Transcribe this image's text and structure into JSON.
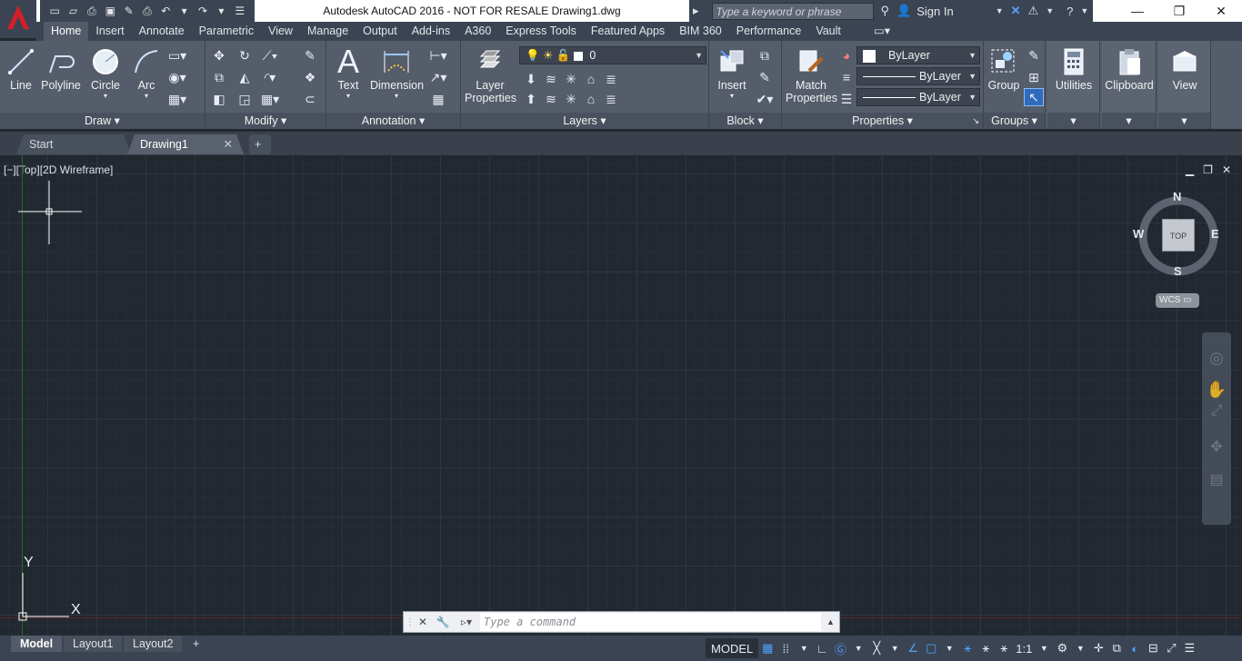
{
  "title": {
    "text": "Autodesk AutoCAD 2016 - NOT FOR RESALE    Drawing1.dwg"
  },
  "search": {
    "placeholder": "Type a keyword or phrase"
  },
  "account": {
    "signin": "Sign In"
  },
  "ribbon_tabs": [
    "Home",
    "Insert",
    "Annotate",
    "Parametric",
    "View",
    "Manage",
    "Output",
    "Add-ins",
    "A360",
    "Express Tools",
    "Featured Apps",
    "BIM 360",
    "Performance",
    "Vault"
  ],
  "draw": {
    "title": "Draw",
    "line": "Line",
    "polyline": "Polyline",
    "circle": "Circle",
    "arc": "Arc"
  },
  "modify": {
    "title": "Modify"
  },
  "annotation": {
    "title": "Annotation",
    "text": "Text",
    "dimension": "Dimension"
  },
  "layers": {
    "title": "Layers",
    "layer_props_1": "Layer",
    "layer_props_2": "Properties",
    "current_layer": "0"
  },
  "block": {
    "title": "Block",
    "insert": "Insert"
  },
  "properties": {
    "title": "Properties",
    "match_1": "Match",
    "match_2": "Properties",
    "color": "ByLayer",
    "linetype": "ByLayer",
    "lineweight": "ByLayer"
  },
  "groups": {
    "title": "Groups",
    "group": "Group"
  },
  "utilities": {
    "label": "Utilities"
  },
  "clipboard": {
    "label": "Clipboard"
  },
  "view": {
    "label": "View"
  },
  "doc_tabs": {
    "start": "Start",
    "drawing": "Drawing1"
  },
  "viewport": {
    "label": "[−][Top][2D Wireframe]",
    "compass": {
      "n": "N",
      "s": "S",
      "e": "E",
      "w": "W",
      "top": "TOP"
    },
    "wcs": "WCS"
  },
  "ucs": {
    "x": "X",
    "y": "Y"
  },
  "command": {
    "placeholder": "Type a command"
  },
  "layout_tabs": {
    "model": "Model",
    "layout1": "Layout1",
    "layout2": "Layout2"
  },
  "status": {
    "model": "MODEL",
    "scale": "1:1"
  }
}
